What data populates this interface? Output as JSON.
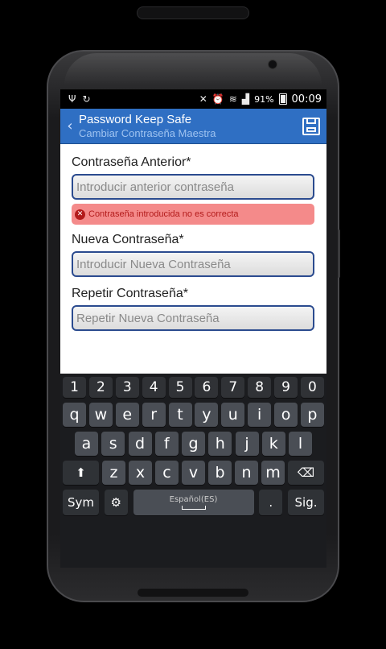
{
  "status_bar": {
    "battery_pct": "91%",
    "time": "00:09"
  },
  "action_bar": {
    "title": "Password Keep Safe",
    "subtitle": "Cambiar Contraseña Maestra"
  },
  "form": {
    "old_password": {
      "label": "Contraseña Anterior*",
      "placeholder": "Introducir anterior contraseña",
      "value": ""
    },
    "error": "Contraseña introducida no es correcta",
    "new_password": {
      "label": "Nueva Contraseña*",
      "placeholder": "Introducir Nueva Contraseña",
      "value": ""
    },
    "repeat_password": {
      "label": "Repetir Contraseña*",
      "placeholder": "Repetir Nueva Contraseña",
      "value": ""
    }
  },
  "keyboard": {
    "row_numbers": [
      "1",
      "2",
      "3",
      "4",
      "5",
      "6",
      "7",
      "8",
      "9",
      "0"
    ],
    "row1": [
      "q",
      "w",
      "e",
      "r",
      "t",
      "y",
      "u",
      "i",
      "o",
      "p"
    ],
    "row2": [
      "a",
      "s",
      "d",
      "f",
      "g",
      "h",
      "j",
      "k",
      "l"
    ],
    "row3": [
      "z",
      "x",
      "c",
      "v",
      "b",
      "n",
      "m"
    ],
    "sym_label": "Sym",
    "space_label": "Español(ES)",
    "period_label": ".",
    "next_label": "Sig."
  },
  "colors": {
    "action_bar": "#2f6fc3",
    "error_bg": "#f48a8a",
    "error_text": "#b31b1b",
    "input_border": "#2b4b8f"
  }
}
